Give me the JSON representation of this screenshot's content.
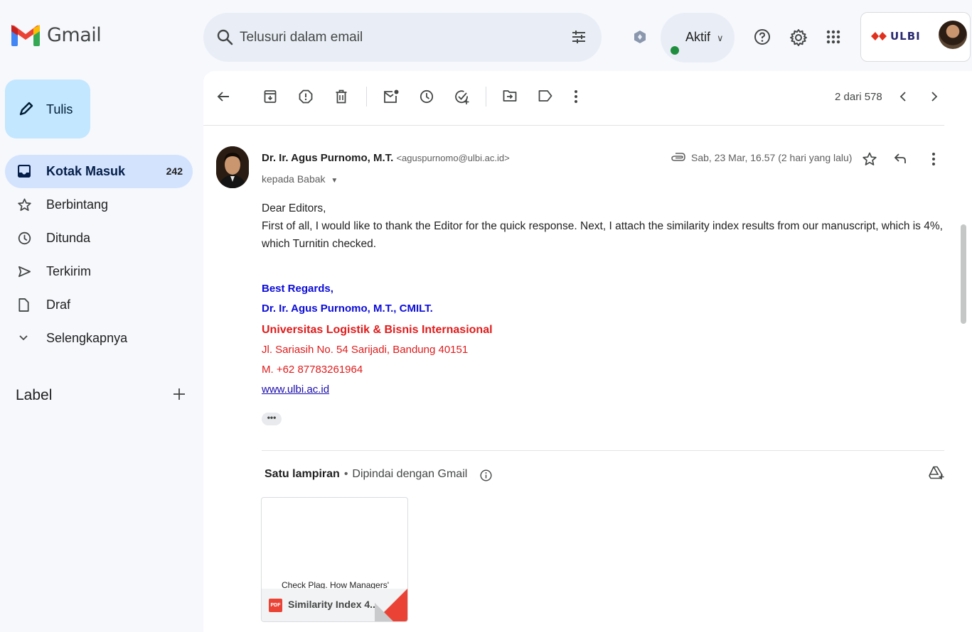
{
  "app": {
    "name": "Gmail"
  },
  "search": {
    "placeholder": "Telusuri dalam email"
  },
  "status": {
    "label": "Aktif",
    "color": "#1e8e3e"
  },
  "account": {
    "org_logo_text": "ULBI"
  },
  "compose": {
    "label": "Tulis"
  },
  "sidebar": {
    "items": [
      {
        "label": "Kotak Masuk",
        "count": "242",
        "icon": "inbox-icon",
        "active": true
      },
      {
        "label": "Berbintang",
        "icon": "star-icon"
      },
      {
        "label": "Ditunda",
        "icon": "clock-icon"
      },
      {
        "label": "Terkirim",
        "icon": "send-icon"
      },
      {
        "label": "Draf",
        "icon": "draft-icon"
      },
      {
        "label": "Selengkapnya",
        "icon": "chevron-down-icon"
      }
    ],
    "labels_header": "Label"
  },
  "toolbar": {
    "pager": "2 dari 578"
  },
  "message": {
    "sender_name": "Dr. Ir. Agus Purnomo, M.T.",
    "sender_email": "<aguspurnomo@ulbi.ac.id>",
    "recipient": "kepada Babak",
    "date": "Sab, 23 Mar, 16.57 (2 hari yang lalu)",
    "greeting": "Dear Editors,",
    "body_line1": "First of all, I would like to thank the Editor for the quick response. Next, I attach the similarity index results from our manuscript, which is 4%,",
    "body_line2": "which Turnitin checked.",
    "signature": {
      "regards": "Best Regards,",
      "name": "Dr. Ir. Agus Purnomo, M.T., CMILT.",
      "org": "Universitas Logistik & Bisnis Internasional",
      "address": "Jl. Sariasih No. 54 Sarijadi, Bandung 40151",
      "phone": "M. +62 87783261964",
      "website": "www.ulbi.ac.id"
    },
    "more": "•••"
  },
  "attachments": {
    "title": "Satu lampiran",
    "separator": "•",
    "scan_note": "Dipindai dengan Gmail",
    "items": [
      {
        "preview_text": "Check Plag. How Managers'",
        "type_badge": "PDF",
        "name": "Similarity Index 4..."
      }
    ]
  },
  "colors": {
    "accent": "#c2e7ff",
    "active_nav": "#d3e3fd",
    "signature_blue": "#0b0bd9",
    "signature_red": "#e01b1b",
    "pdf_red": "#ea4335"
  }
}
